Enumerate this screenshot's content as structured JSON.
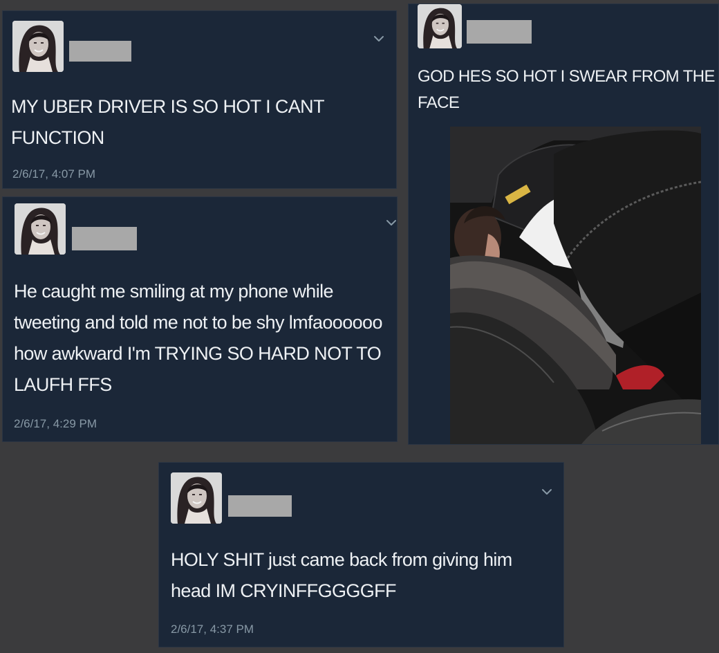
{
  "tweets": [
    {
      "text": "MY UBER DRIVER IS SO HOT I CANT FUNCTION",
      "timestamp": "2/6/17, 4:07 PM"
    },
    {
      "text": "He caught me smiling at my phone while tweeting and told me not to be shy lmfaoooooo how awkward I'm TRYING SO HARD NOT TO LAUFH FFS",
      "timestamp": "2/6/17, 4:29 PM"
    },
    {
      "text": "GOD HES SO HOT I SWEAR FROM THE FACE"
    },
    {
      "text": "HOLY SHIT just came back from giving him head IM CRYINFFGGGGFF",
      "timestamp": "2/6/17, 4:37 PM"
    }
  ],
  "icons": {
    "menu": "chevron-down-icon",
    "avatar": "profile-avatar"
  },
  "colors": {
    "page_background": "#3b3b3d",
    "card_background": "#1b2738",
    "text": "#eef1f4",
    "timestamp": "#8899a6",
    "redaction": "#a8a8a8"
  }
}
